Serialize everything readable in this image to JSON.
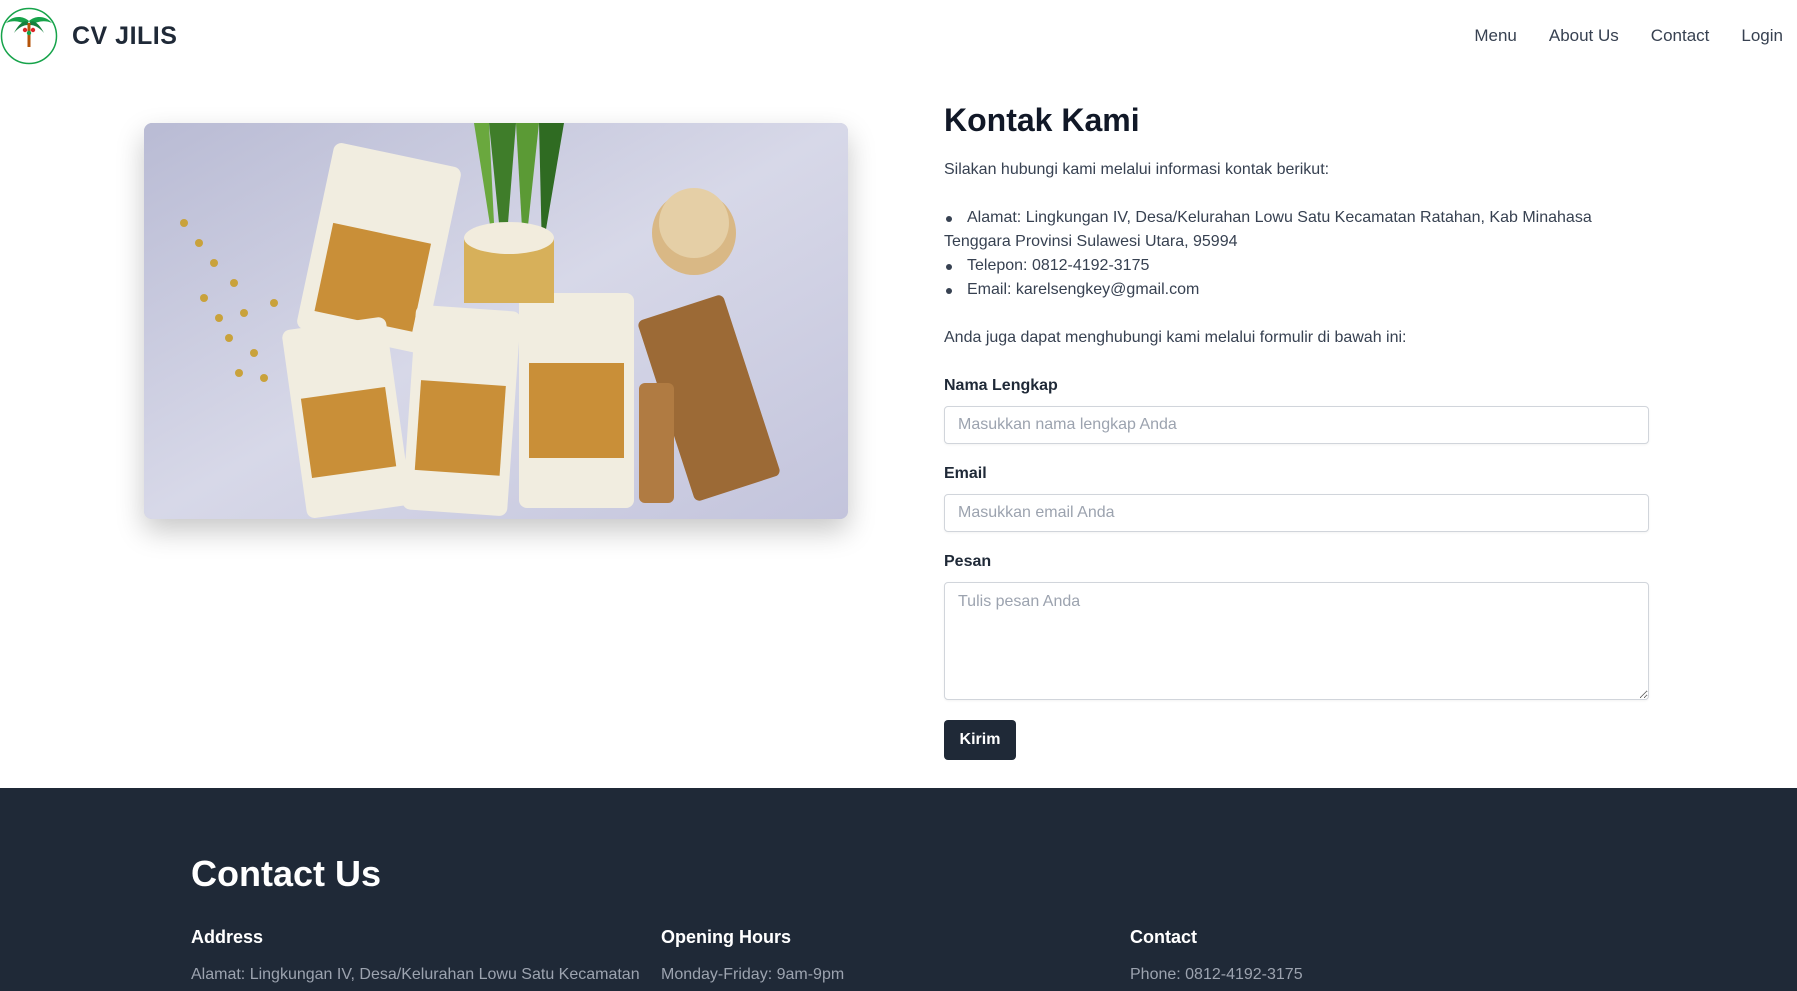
{
  "brand": {
    "name": "CV JILIS",
    "logo_text": "JILIS"
  },
  "nav": [
    "Menu",
    "About Us",
    "Contact",
    "Login"
  ],
  "contact": {
    "title": "Kontak Kami",
    "intro": "Silakan hubungi kami melalui informasi kontak berikut:",
    "items": [
      "Alamat: Lingkungan IV, Desa/Kelurahan Lowu Satu Kecamatan Ratahan, Kab Minahasa Tenggara Provinsi Sulawesi Utara, 95994",
      "Telepon: 0812-4192-3175",
      "Email: karelsengkey@gmail.com"
    ],
    "outro": "Anda juga dapat menghubungi kami melalui formulir di bawah ini:"
  },
  "form": {
    "name_label": "Nama Lengkap",
    "name_placeholder": "Masukkan nama lengkap Anda",
    "email_label": "Email",
    "email_placeholder": "Masukkan email Anda",
    "message_label": "Pesan",
    "message_placeholder": "Tulis pesan Anda",
    "submit_label": "Kirim"
  },
  "footer": {
    "title": "Contact Us",
    "address": {
      "heading": "Address",
      "text": "Alamat: Lingkungan IV, Desa/Kelurahan Lowu Satu Kecamatan"
    },
    "hours": {
      "heading": "Opening Hours",
      "text": "Monday-Friday: 9am-9pm"
    },
    "contact": {
      "heading": "Contact",
      "text": "Phone: 0812-4192-3175"
    }
  },
  "colors": {
    "dark": "#1f2937",
    "muted": "#9ca3af",
    "logo_green": "#16a34a",
    "logo_red": "#dc2626"
  }
}
